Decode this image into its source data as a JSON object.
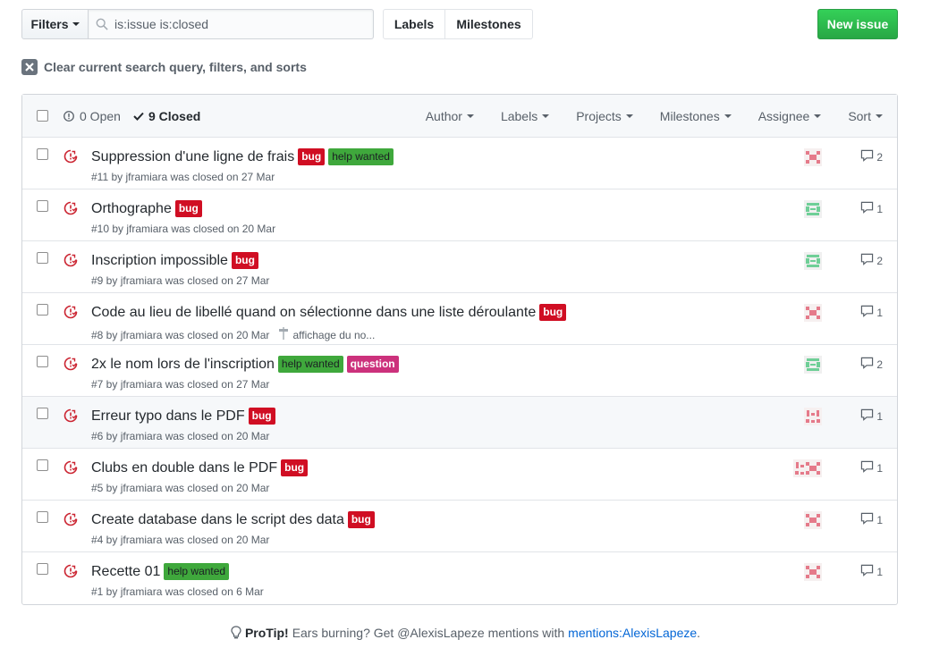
{
  "toolbar": {
    "filters_label": "Filters",
    "search_value": "is:issue is:closed",
    "labels_label": "Labels",
    "milestones_label": "Milestones",
    "new_issue_label": "New issue",
    "clear_label": "Clear current search query, filters, and sorts"
  },
  "header": {
    "open_label": "0 Open",
    "closed_label": "9 Closed",
    "filters": [
      "Author",
      "Labels",
      "Projects",
      "Milestones",
      "Assignee",
      "Sort"
    ]
  },
  "issues": [
    {
      "title": "Suppression d'une ligne de frais",
      "labels": [
        "bug",
        "help wanted"
      ],
      "meta": "#11 by jframiara was closed on 27 Mar",
      "milestone": "",
      "comments": "2",
      "avatar": "red-x"
    },
    {
      "title": "Orthographe",
      "labels": [
        "bug"
      ],
      "meta": "#10 by jframiara was closed on 20 Mar",
      "milestone": "",
      "comments": "1",
      "avatar": "green"
    },
    {
      "title": "Inscription impossible",
      "labels": [
        "bug"
      ],
      "meta": "#9 by jframiara was closed on 27 Mar",
      "milestone": "",
      "comments": "2",
      "avatar": "green"
    },
    {
      "title": "Code au lieu de libellé quand on sélectionne dans une liste déroulante",
      "labels": [
        "bug"
      ],
      "meta": "#8 by jframiara was closed on 20 Mar",
      "milestone": "affichage du no...",
      "comments": "1",
      "avatar": "red-x"
    },
    {
      "title": "2x le nom lors de l'inscription",
      "labels": [
        "help wanted",
        "question"
      ],
      "meta": "#7 by jframiara was closed on 27 Mar",
      "milestone": "",
      "comments": "2",
      "avatar": "green"
    },
    {
      "title": "Erreur typo dans le PDF",
      "labels": [
        "bug"
      ],
      "meta": "#6 by jframiara was closed on 20 Mar",
      "milestone": "",
      "comments": "1",
      "avatar": "red-dots"
    },
    {
      "title": "Clubs en double dans le PDF",
      "labels": [
        "bug"
      ],
      "meta": "#5 by jframiara was closed on 20 Mar",
      "milestone": "",
      "comments": "1",
      "avatar": "double"
    },
    {
      "title": "Create database dans le script des data",
      "labels": [
        "bug"
      ],
      "meta": "#4 by jframiara was closed on 20 Mar",
      "milestone": "",
      "comments": "1",
      "avatar": "red-x"
    },
    {
      "title": "Recette 01",
      "labels": [
        "help wanted"
      ],
      "meta": "#1 by jframiara was closed on 6 Mar",
      "milestone": "",
      "comments": "1",
      "avatar": "red-x"
    }
  ],
  "protip": {
    "prefix": "ProTip!",
    "text": "Ears burning? Get @AlexisLapeze mentions with",
    "link": "mentions:AlexisLapeze",
    "suffix": "."
  },
  "colors": {
    "bug": "#d00e23",
    "help_wanted": "#3fa83c",
    "question": "#cc317c",
    "new_issue": "#2cbe4e",
    "closed_icon": "#cb2431"
  }
}
